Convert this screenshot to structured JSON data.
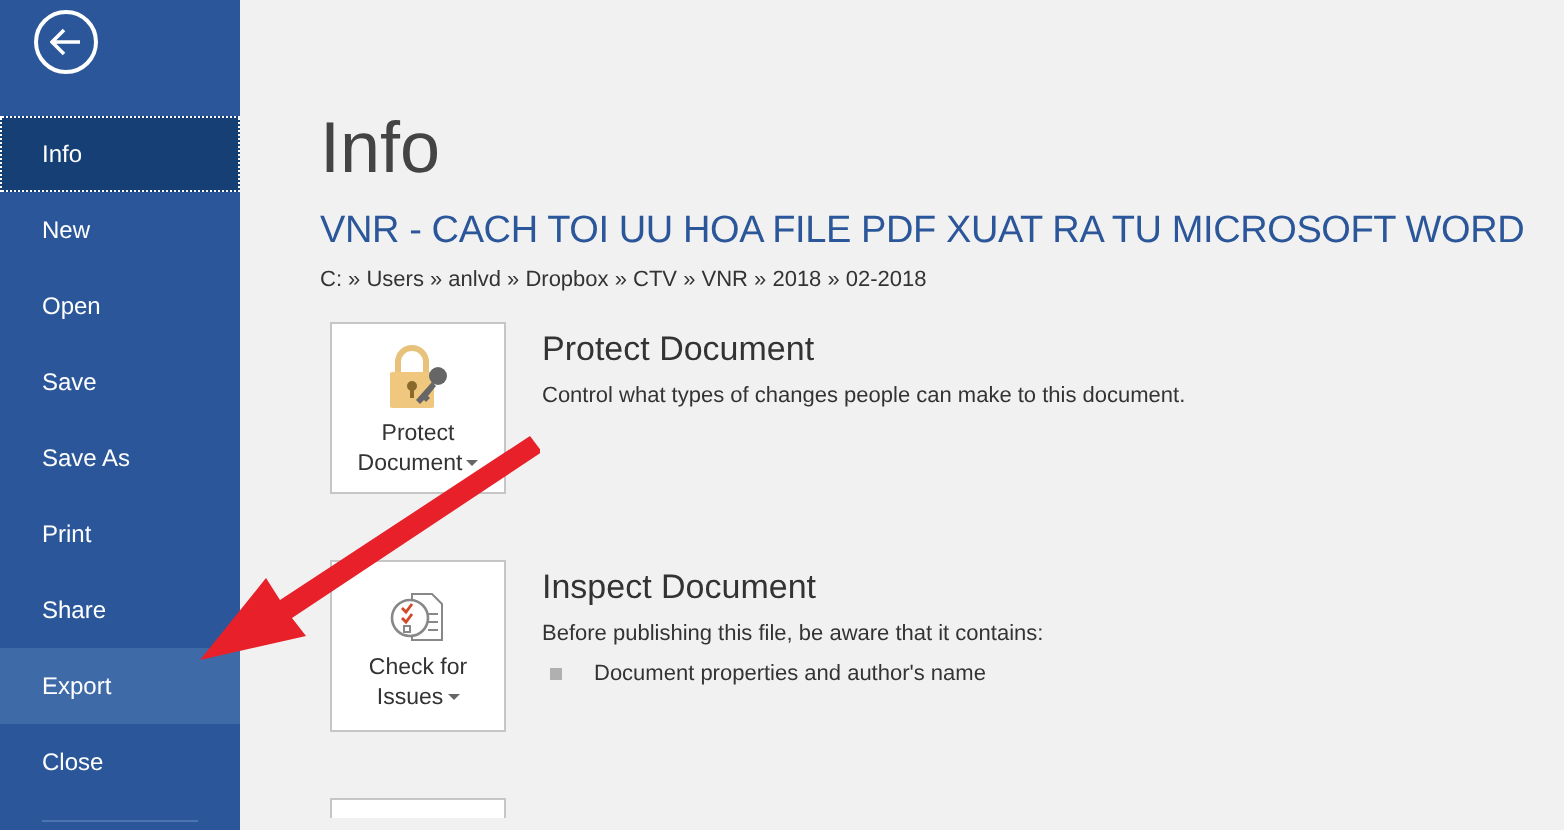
{
  "sidebar": {
    "items": [
      {
        "label": "Info",
        "selected": true,
        "highlighted": false
      },
      {
        "label": "New",
        "selected": false,
        "highlighted": false
      },
      {
        "label": "Open",
        "selected": false,
        "highlighted": false
      },
      {
        "label": "Save",
        "selected": false,
        "highlighted": false
      },
      {
        "label": "Save As",
        "selected": false,
        "highlighted": false
      },
      {
        "label": "Print",
        "selected": false,
        "highlighted": false
      },
      {
        "label": "Share",
        "selected": false,
        "highlighted": false
      },
      {
        "label": "Export",
        "selected": false,
        "highlighted": true
      },
      {
        "label": "Close",
        "selected": false,
        "highlighted": false
      }
    ]
  },
  "page_title": "Info",
  "document_title": "VNR - CACH TOI UU HOA FILE PDF XUAT RA TU MICROSOFT WORD",
  "path": "C: » Users » anlvd » Dropbox » CTV » VNR » 2018 » 02-2018",
  "sections": [
    {
      "kind": "protect",
      "button_lines": [
        "Protect",
        "Document"
      ],
      "heading": "Protect Document",
      "description": "Control what types of changes people can make to this document."
    },
    {
      "kind": "inspect",
      "button_lines": [
        "Check for",
        "Issues"
      ],
      "heading": "Inspect Document",
      "description": "Before publishing this file, be aware that it contains:",
      "bullets": [
        "Document properties and author's name"
      ]
    }
  ]
}
